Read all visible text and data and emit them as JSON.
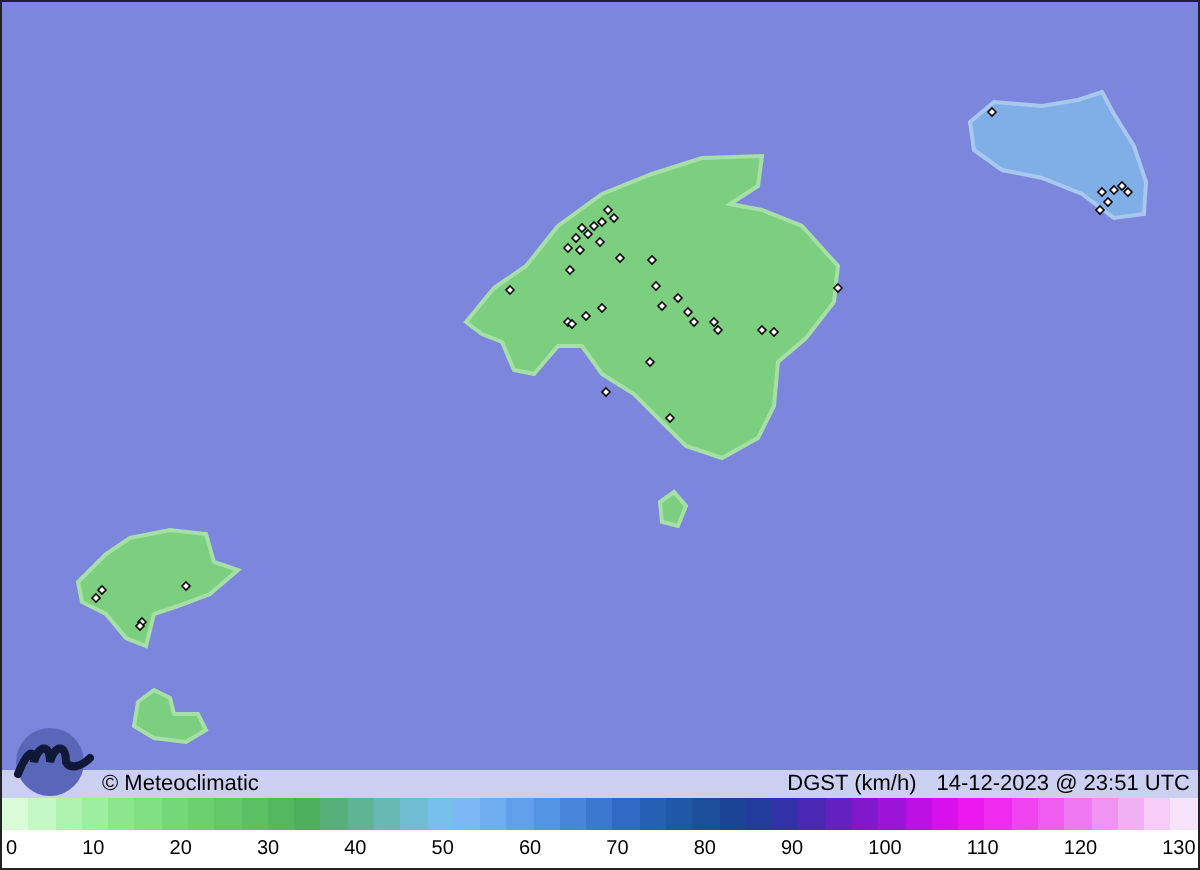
{
  "credit": {
    "text": "© Meteoclimatic"
  },
  "header": {
    "variable": "DGST (km/h)",
    "timestamp": "14-12-2023 @ 23:51 UTC"
  },
  "legend": {
    "ticks": [
      "0",
      "10",
      "20",
      "30",
      "40",
      "50",
      "60",
      "70",
      "80",
      "90",
      "100",
      "110",
      "120",
      "130"
    ]
  }
}
